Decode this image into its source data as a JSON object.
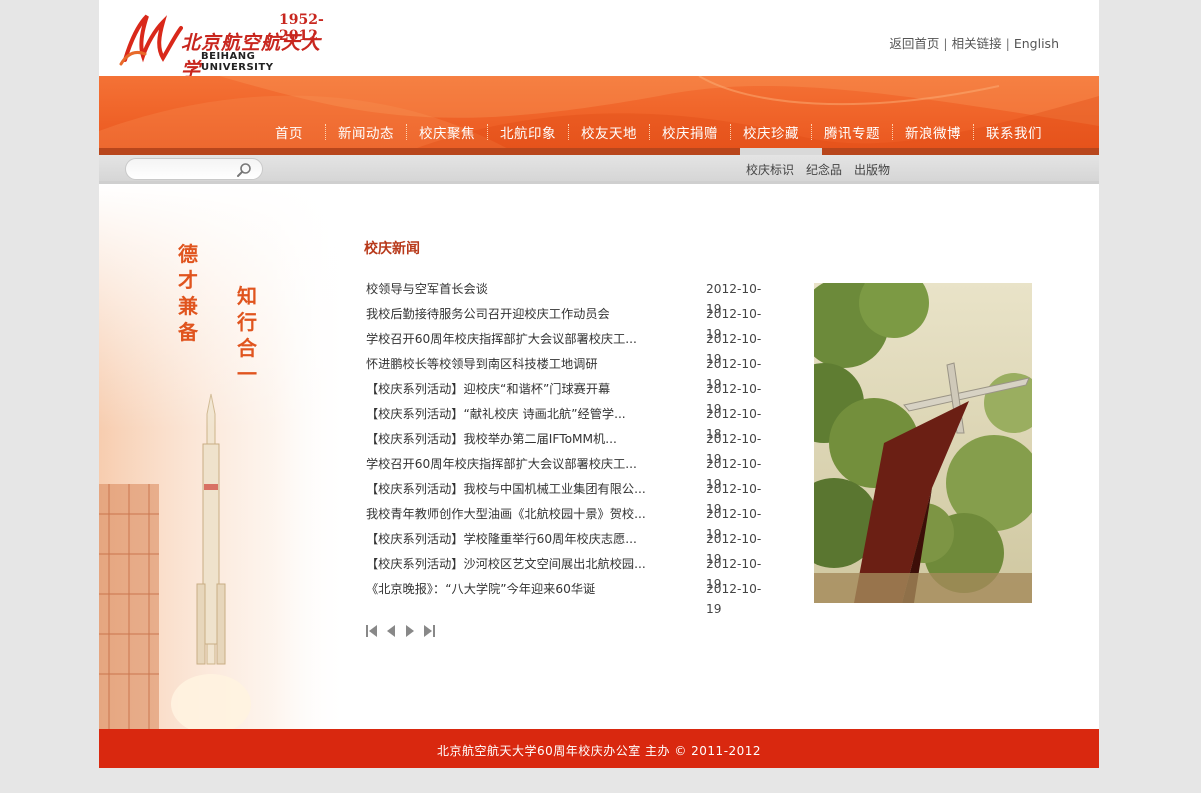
{
  "header": {
    "logo_years": "1952-2012",
    "logo_cn": "北京航空航天大学",
    "logo_en": "BEIHANG UNIVERSITY",
    "links": [
      {
        "label": "返回首页"
      },
      {
        "label": "相关链接"
      },
      {
        "label": "English"
      }
    ],
    "separator": "|"
  },
  "nav": {
    "items": [
      {
        "label": "首页"
      },
      {
        "label": "新闻动态"
      },
      {
        "label": "校庆聚焦"
      },
      {
        "label": "北航印象"
      },
      {
        "label": "校友天地"
      },
      {
        "label": "校庆捐赠"
      },
      {
        "label": "校庆珍藏"
      },
      {
        "label": "腾讯专题"
      },
      {
        "label": "新浪微博"
      },
      {
        "label": "联系我们"
      }
    ],
    "active": "校庆珍藏"
  },
  "search": {
    "placeholder": ""
  },
  "subnav": {
    "items": [
      {
        "label": "校庆标识"
      },
      {
        "label": "纪念品"
      },
      {
        "label": "出版物"
      }
    ]
  },
  "left_panel": {
    "motto_col1": "德才兼备",
    "motto_col2": "知行合一"
  },
  "main": {
    "section_title": "校庆新闻",
    "news": [
      {
        "title": "校领导与空军首长会谈",
        "date": "2012-10-19"
      },
      {
        "title": "我校后勤接待服务公司召开迎校庆工作动员会",
        "date": "2012-10-19"
      },
      {
        "title": "学校召开60周年校庆指挥部扩大会议部署校庆工...",
        "date": "2012-10-19"
      },
      {
        "title": "怀进鹏校长等校领导到南区科技楼工地调研",
        "date": "2012-10-19"
      },
      {
        "title": "【校庆系列活动】迎校庆“和谐杯”门球赛开幕",
        "date": "2012-10-19"
      },
      {
        "title": "【校庆系列活动】“献礼校庆 诗画北航”经管学...",
        "date": "2012-10-18"
      },
      {
        "title": "【校庆系列活动】我校举办第二届IFToMM机...",
        "date": "2012-10-19"
      },
      {
        "title": "学校召开60周年校庆指挥部扩大会议部署校庆工...",
        "date": "2012-10-19"
      },
      {
        "title": "【校庆系列活动】我校与中国机械工业集团有限公...",
        "date": "2012-10-19"
      },
      {
        "title": "我校青年教师创作大型油画《北航校园十景》贺校...",
        "date": "2012-10-19"
      },
      {
        "title": "【校庆系列活动】学校隆重举行60周年校庆志愿...",
        "date": "2012-10-19"
      },
      {
        "title": "【校庆系列活动】沙河校区艺文空间展出北航校园...",
        "date": "2012-10-19"
      },
      {
        "title": "《北京晚报》：“八大学院”今年迎来60华诞",
        "date": "2012-10-19"
      }
    ]
  },
  "footer": {
    "text": "北京航空航天大学60周年校庆办公室 主办 © 2011-2012"
  },
  "colors": {
    "brand_orange": "#f0652a",
    "brand_red": "#d9280f",
    "title_red": "#b8391a",
    "motto_orange": "#e0541e"
  },
  "icons": {
    "search": "magnifier-icon",
    "pager": [
      "first-page-icon",
      "prev-page-icon",
      "next-page-icon",
      "last-page-icon"
    ]
  }
}
